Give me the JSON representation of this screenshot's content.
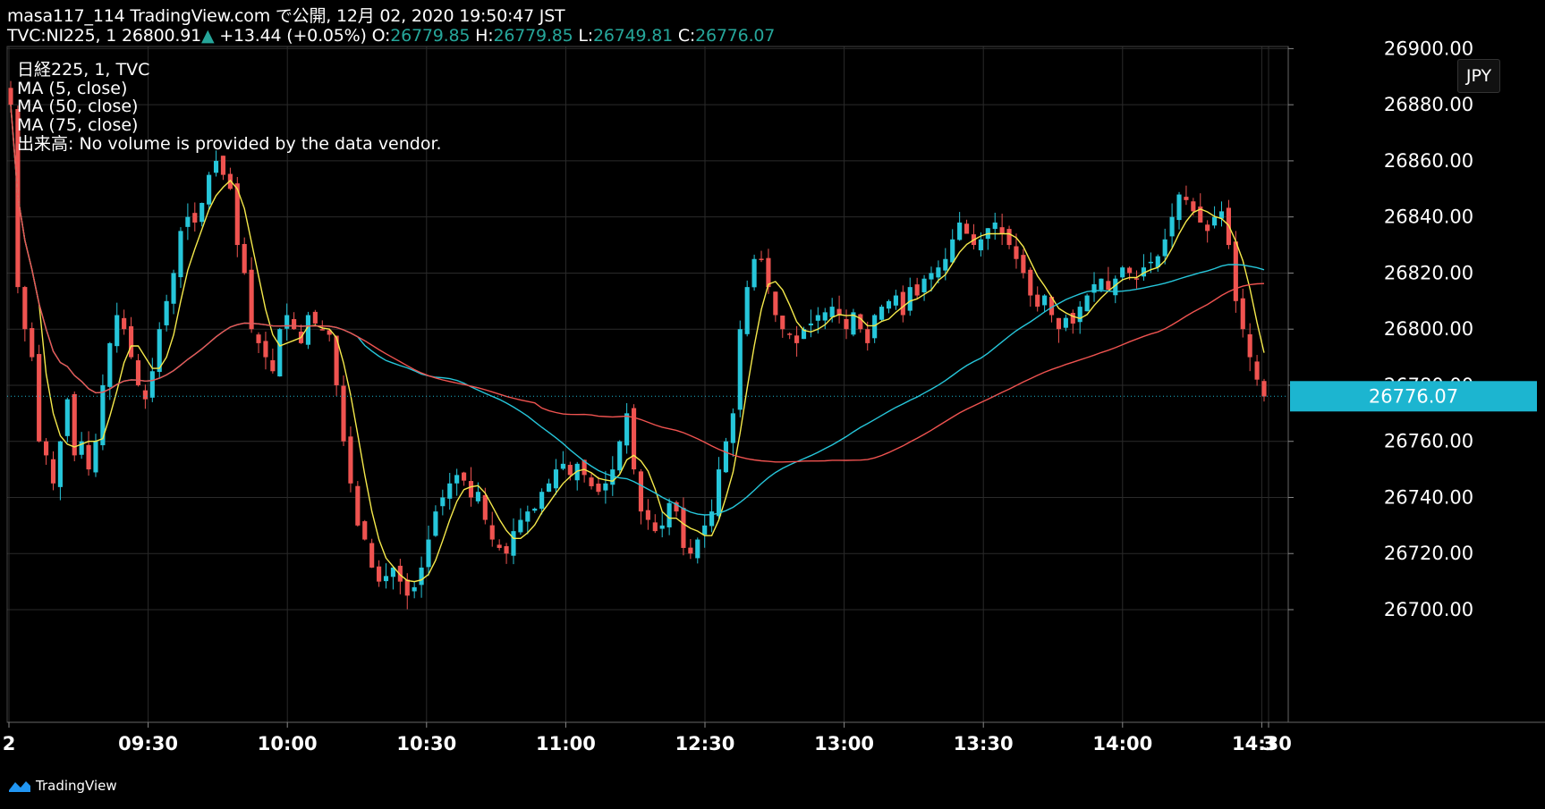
{
  "header": {
    "line1": "masa117_114 TradingView.com で公開, 12月 02, 2020 19:50:47 JST",
    "symbol": "TVC:NI225, 1",
    "last": "26800.91",
    "arrow": "▲",
    "change": "+13.44 (+0.05%)",
    "o_label": "O:",
    "o": "26779.85",
    "h_label": "H:",
    "h": "26779.85",
    "l_label": "L:",
    "l": "26749.81",
    "c_label": "C:",
    "c": "26776.07"
  },
  "legend": {
    "title": "日経225, 1, TVC",
    "ma5": "MA (5, close)",
    "ma50": "MA (50, close)",
    "ma75": "MA (75, close)",
    "volume": "出来高: No volume is provided by the data vendor."
  },
  "currency": "JPY",
  "brand": "TradingView",
  "colors": {
    "up": "#26c6da",
    "down": "#ef5350",
    "ma5": "#f5e94b",
    "ma50": "#26c6da",
    "ma75": "#ef5350",
    "price_tag": "#1cb5d0"
  },
  "chart_data": {
    "type": "candlestick",
    "interval": "1",
    "ylim": [
      26680,
      26905
    ],
    "y_ticks": [
      26700,
      26720,
      26740,
      26760,
      26780,
      26800,
      26820,
      26840,
      26860,
      26880,
      26900
    ],
    "y_tick_labels": [
      "26700.00",
      "26720.00",
      "26740.00",
      "26760.00",
      "26780.00",
      "26800.00",
      "26820.00",
      "26840.00",
      "26860.00",
      "26880.00",
      "26900.00"
    ],
    "x_labels": [
      "2",
      "09:30",
      "10:00",
      "10:30",
      "11:00",
      "12:30",
      "13:00",
      "13:30",
      "14:00",
      "14:30",
      "3"
    ],
    "current_price": 26776.07,
    "current_price_label": "26776.07",
    "close_series": [
      26880,
      26815,
      26800,
      26790,
      26760,
      26755,
      26745,
      26760,
      26775,
      26755,
      26760,
      26750,
      26760,
      26780,
      26795,
      26805,
      26800,
      26790,
      26780,
      26775,
      26785,
      26800,
      26810,
      26820,
      26835,
      26840,
      26838,
      26845,
      26855,
      26860,
      26855,
      26850,
      26830,
      26820,
      26800,
      26795,
      26790,
      26785,
      26800,
      26805,
      26800,
      26795,
      26805,
      26802,
      26800,
      26798,
      26780,
      26760,
      26745,
      26730,
      26725,
      26715,
      26710,
      26712,
      26715,
      26710,
      26705,
      26708,
      26715,
      26725,
      26735,
      26740,
      26745,
      26748,
      26746,
      26740,
      26742,
      26732,
      26725,
      26722,
      26720,
      26728,
      26732,
      26735,
      26736,
      26742,
      26745,
      26750,
      26752,
      26748,
      26752,
      26748,
      26744,
      26742,
      26745,
      26750,
      26760,
      26770,
      26750,
      26735,
      26732,
      26728,
      26730,
      26738,
      26735,
      26722,
      26720,
      26725,
      26730,
      26735,
      26750,
      26760,
      26770,
      26800,
      26815,
      26825,
      26825,
      26815,
      26805,
      26800,
      26798,
      26795,
      26800,
      26802,
      26805,
      26806,
      26808,
      26805,
      26800,
      26806,
      26800,
      26795,
      26805,
      26808,
      26810,
      26812,
      26805,
      26815,
      26812,
      26818,
      26820,
      26822,
      26825,
      26832,
      26838,
      26834,
      26830,
      26832,
      26836,
      26838,
      26834,
      26830,
      26825,
      26820,
      26812,
      26808,
      26812,
      26805,
      26800,
      26804,
      26802,
      26808,
      26812,
      26816,
      26818,
      26814,
      26818,
      26822,
      26820,
      26818,
      26822,
      26824,
      26826,
      26832,
      26840,
      26848,
      26846,
      26842,
      26838,
      26835,
      26840,
      26842,
      26830,
      26810,
      26800,
      26790,
      26782,
      26776
    ]
  }
}
